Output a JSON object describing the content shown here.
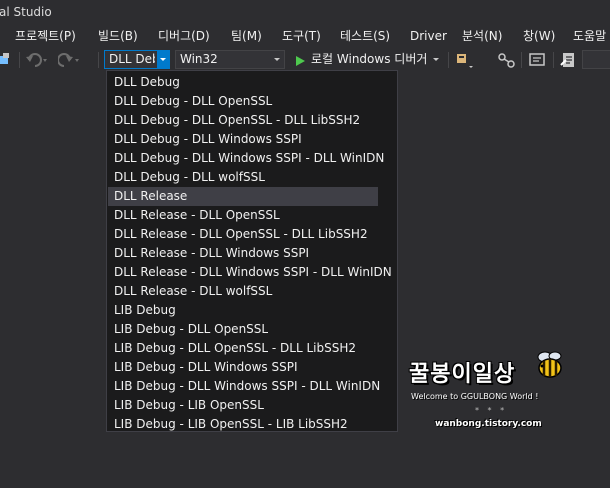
{
  "window": {
    "title": "al Studio"
  },
  "menu": [
    {
      "label": "프로젝트(P)"
    },
    {
      "label": "빌드(B)"
    },
    {
      "label": "디버그(D)"
    },
    {
      "label": "팀(M)"
    },
    {
      "label": "도구(T)"
    },
    {
      "label": "테스트(S)"
    },
    {
      "label": "Driver"
    },
    {
      "label": "분석(N)"
    },
    {
      "label": "창(W)"
    },
    {
      "label": "도움말"
    }
  ],
  "toolbar": {
    "config_value": "DLL Debug",
    "platform_value": "Win32",
    "run_label": "로컬 Windows 디버거"
  },
  "dropdown": {
    "items": [
      {
        "label": "DLL Debug"
      },
      {
        "label": "DLL Debug - DLL OpenSSL"
      },
      {
        "label": "DLL Debug - DLL OpenSSL - DLL LibSSH2"
      },
      {
        "label": "DLL Debug - DLL Windows SSPI"
      },
      {
        "label": "DLL Debug - DLL Windows SSPI - DLL WinIDN"
      },
      {
        "label": "DLL Debug - DLL wolfSSL"
      },
      {
        "label": "DLL Release"
      },
      {
        "label": "DLL Release - DLL OpenSSL"
      },
      {
        "label": "DLL Release - DLL OpenSSL - DLL LibSSH2"
      },
      {
        "label": "DLL Release - DLL Windows SSPI"
      },
      {
        "label": "DLL Release - DLL Windows SSPI - DLL WinIDN"
      },
      {
        "label": "DLL Release - DLL wolfSSL"
      },
      {
        "label": "LIB Debug"
      },
      {
        "label": "LIB Debug - DLL OpenSSL"
      },
      {
        "label": "LIB Debug - DLL OpenSSL - DLL LibSSH2"
      },
      {
        "label": "LIB Debug - DLL Windows SSPI"
      },
      {
        "label": "LIB Debug - DLL Windows SSPI - DLL WinIDN"
      },
      {
        "label": "LIB Debug - LIB OpenSSL"
      },
      {
        "label": "LIB Debug - LIB OpenSSL - LIB LibSSH2"
      }
    ],
    "highlighted": "DLL Release"
  },
  "watermark": {
    "title": "꿀봉이일상",
    "welcome": "Welcome to GGULBONG World !",
    "stars": "* * *",
    "url": "wanbong.tistory.com"
  },
  "colors": {
    "background": "#2d2d30",
    "accent": "#007acc",
    "dropdown_bg": "#1b1b1c",
    "selected_row": "#3f3f46",
    "play_green": "#4ec94e"
  },
  "icons": [
    "toolbox-icon",
    "undo-icon",
    "redo-icon",
    "play-icon",
    "find-icon",
    "cursor-icon",
    "comment-icon",
    "script-icon"
  ]
}
